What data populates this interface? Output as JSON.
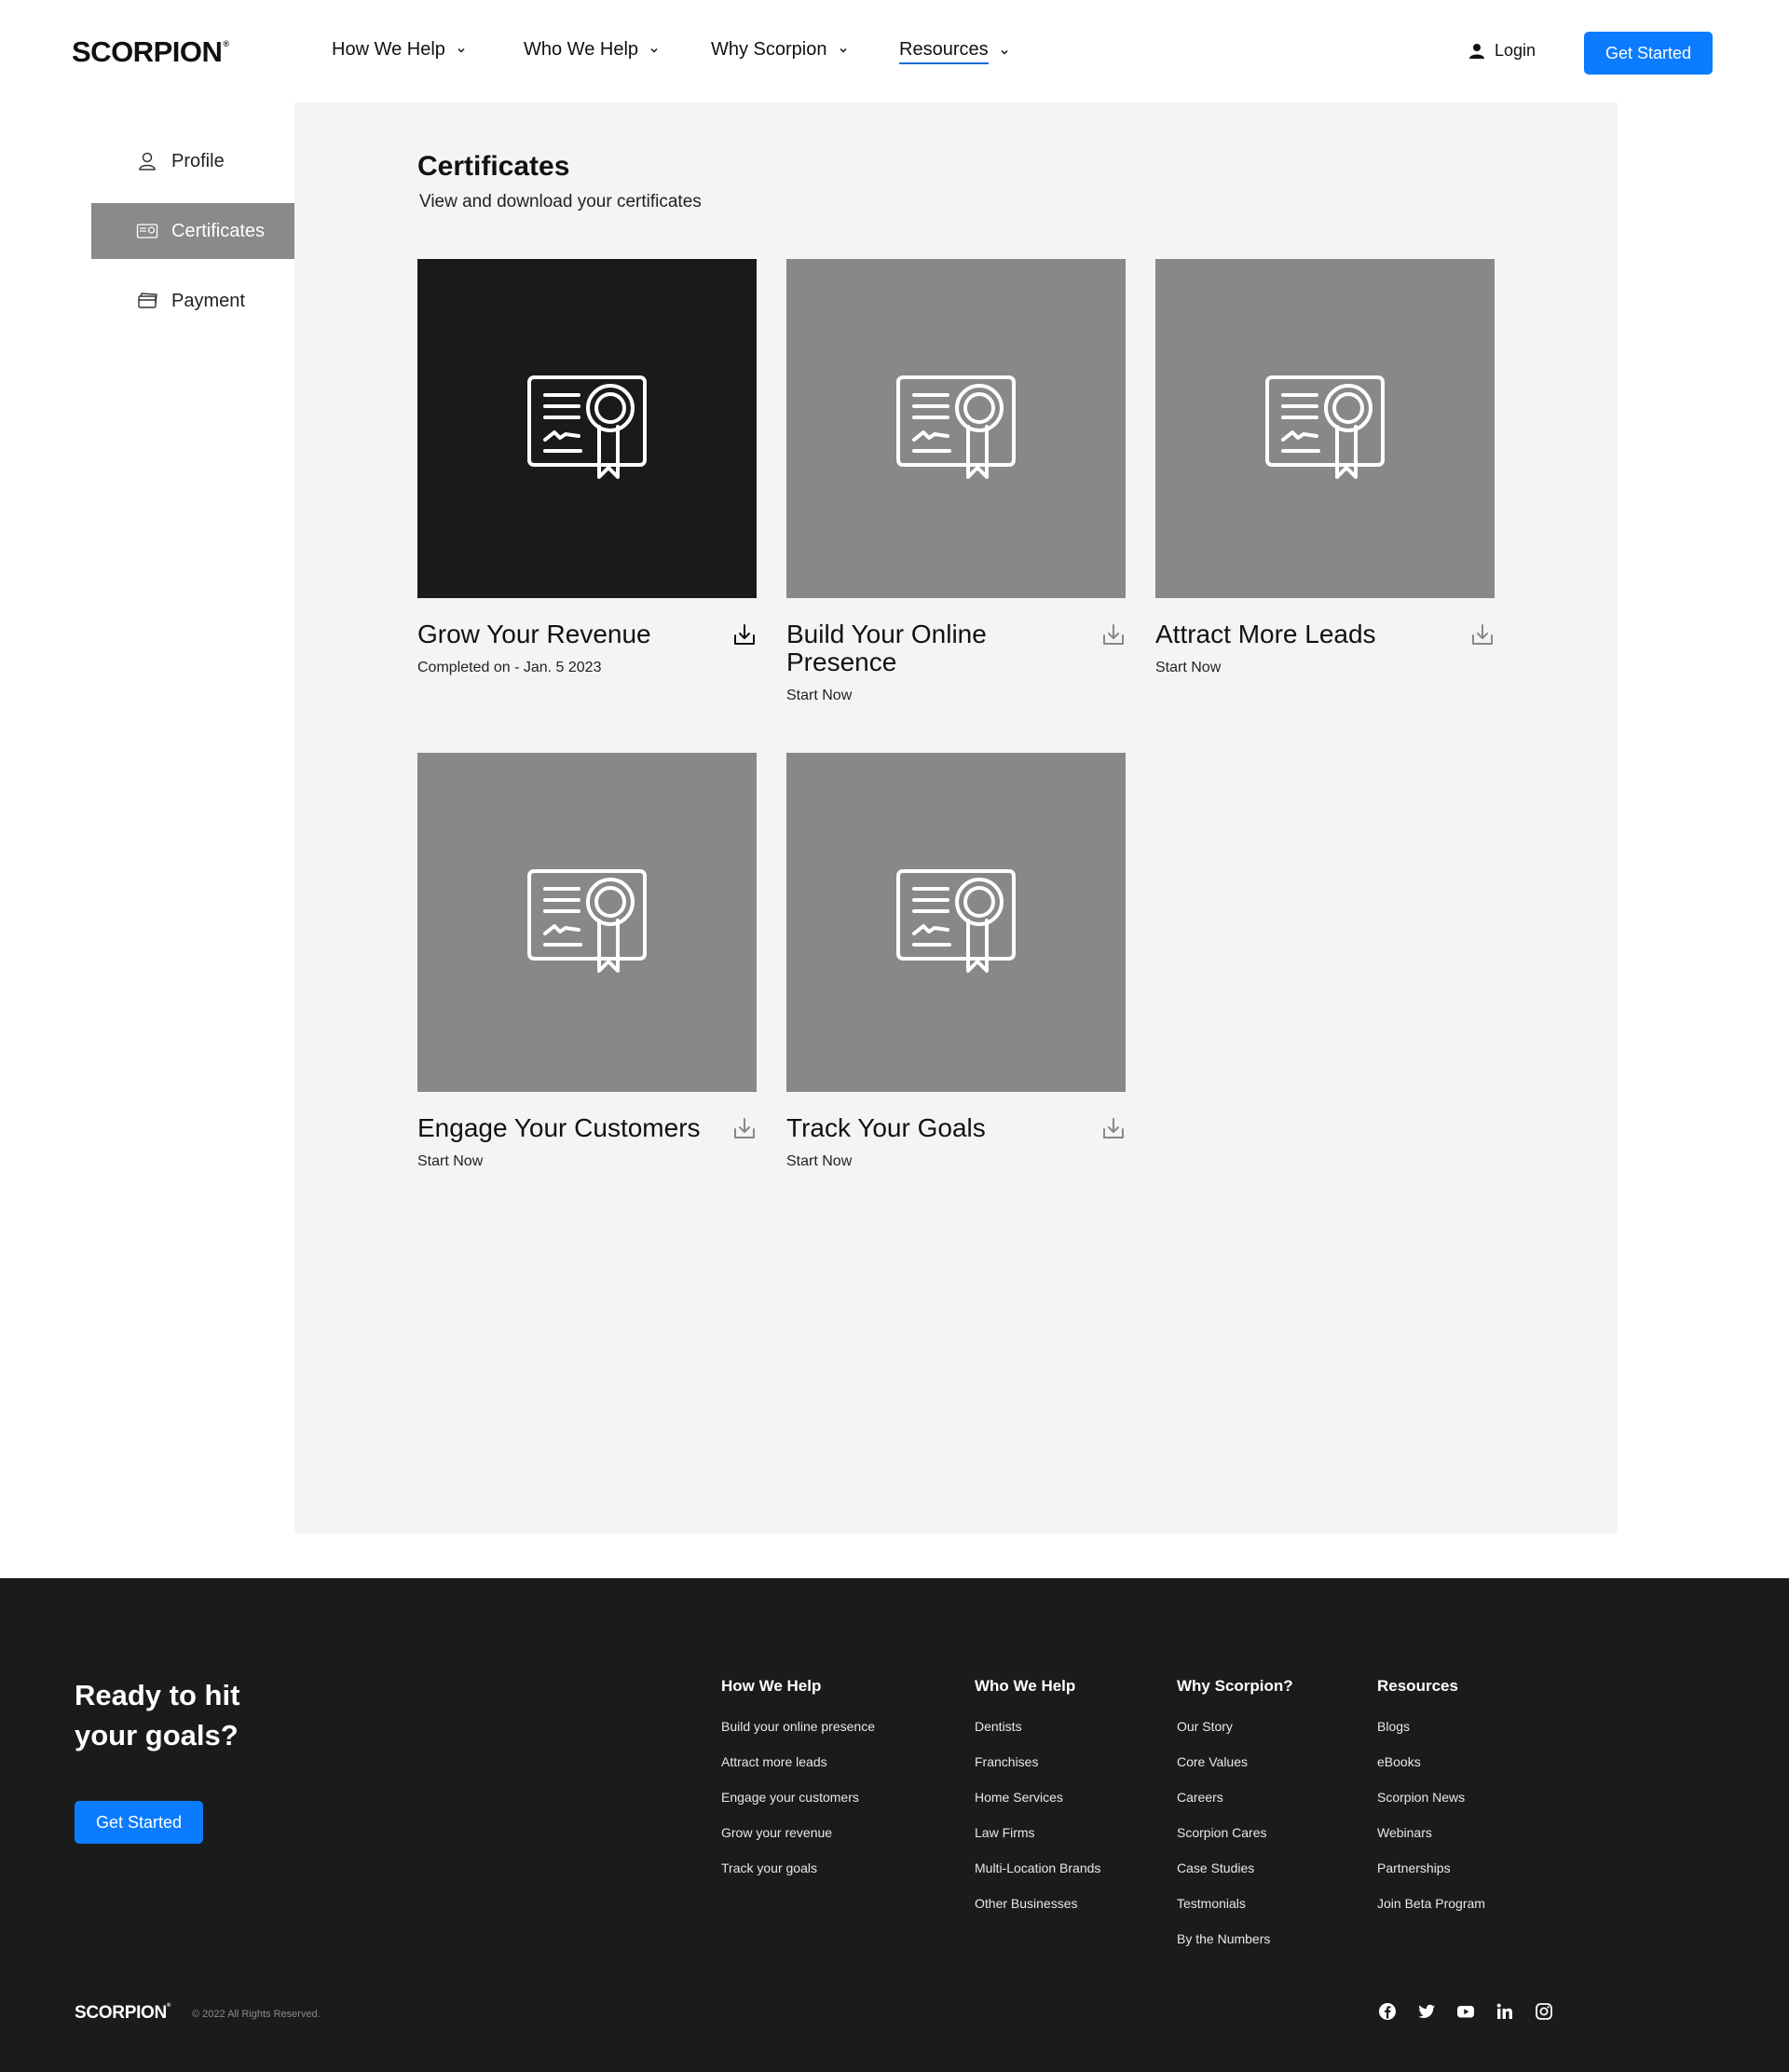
{
  "header": {
    "logo_text": "SCORPION",
    "logo_mark": "®",
    "nav": [
      {
        "label": "How We Help"
      },
      {
        "label": "Who We Help"
      },
      {
        "label": "Why Scorpion"
      },
      {
        "label": "Resources",
        "active": true
      }
    ],
    "login_label": "Login",
    "cta_label": "Get Started"
  },
  "sidebar": {
    "items": [
      {
        "label": "Profile",
        "icon": "user-icon"
      },
      {
        "label": "Certificates",
        "icon": "certificate-icon",
        "active": true
      },
      {
        "label": "Payment",
        "icon": "credit-card-icon"
      }
    ]
  },
  "main": {
    "title": "Certificates",
    "subtitle": "View and download your certificates",
    "cards": [
      {
        "title": "Grow Your Revenue",
        "status": "Completed on - Jan. 5 2023",
        "completed": true
      },
      {
        "title": "Build Your Online Presence",
        "status": "Start Now",
        "completed": false
      },
      {
        "title": "Attract More Leads",
        "status": "Start Now",
        "completed": false
      },
      {
        "title": "Engage Your Customers",
        "status": "Start Now",
        "completed": false
      },
      {
        "title": "Track Your Goals",
        "status": "Start Now",
        "completed": false
      }
    ]
  },
  "footer": {
    "cta_heading": "Ready to hit your goals?",
    "cta_label": "Get Started",
    "columns": [
      {
        "heading": "How We Help",
        "links": [
          "Build your online presence",
          "Attract more leads",
          "Engage your customers",
          "Grow your revenue",
          "Track your goals"
        ]
      },
      {
        "heading": "Who We Help",
        "links": [
          "Dentists",
          "Franchises",
          "Home Services",
          "Law Firms",
          "Multi-Location Brands",
          "Other Businesses"
        ]
      },
      {
        "heading": "Why Scorpion?",
        "links": [
          "Our Story",
          "Core Values",
          "Careers",
          "Scorpion Cares",
          "Case Studies",
          "Testmonials",
          "By the Numbers"
        ]
      },
      {
        "heading": "Resources",
        "links": [
          "Blogs",
          "eBooks",
          "Scorpion News",
          "Webinars",
          "Partnerships",
          "Join Beta Program"
        ]
      }
    ],
    "logo_text": "SCORPION",
    "logo_mark": "®",
    "copyright": "© 2022 All Rights Reserved.",
    "social": [
      "facebook-icon",
      "twitter-icon",
      "youtube-icon",
      "linkedin-icon",
      "instagram-icon"
    ]
  },
  "colors": {
    "accent": "#0b7bff",
    "panel_bg": "#f4f4f4",
    "card_gray": "#888888",
    "card_dark": "#1a1a1a",
    "footer_bg": "#1b1b1b",
    "sidebar_active": "#8a8a8a"
  }
}
